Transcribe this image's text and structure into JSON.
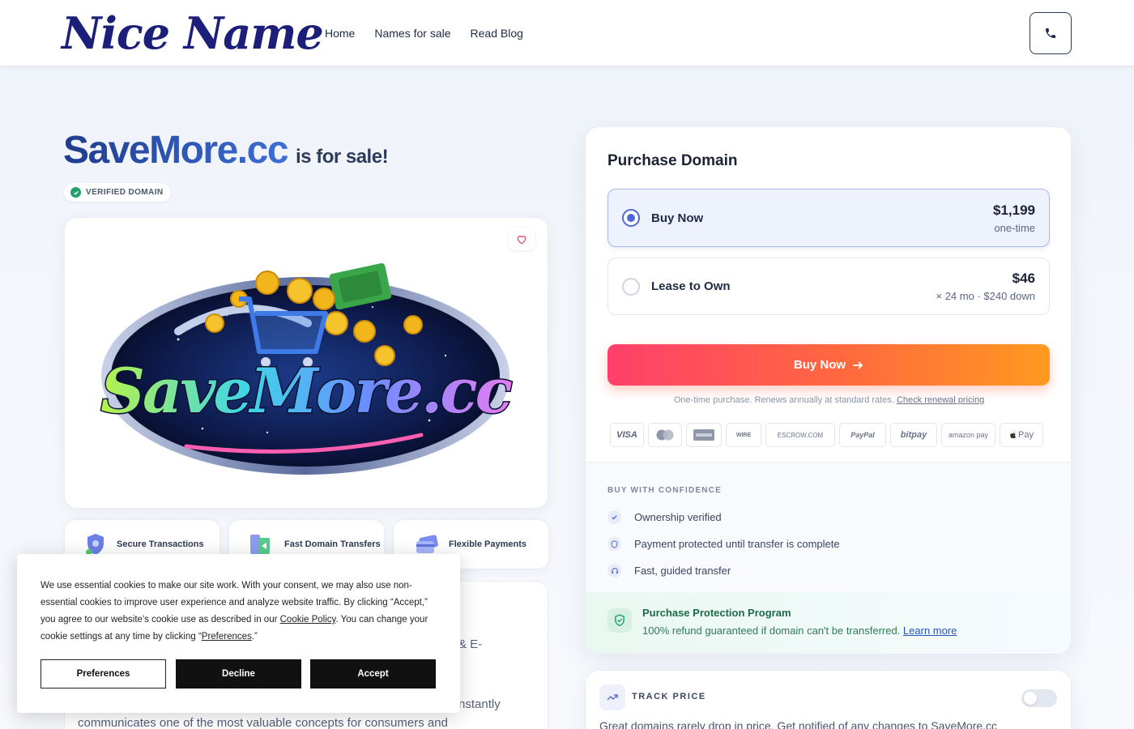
{
  "header": {
    "logo": "Nice Name",
    "nav": [
      "Home",
      "Names for sale",
      "Read Blog"
    ],
    "phone_icon": "phone-icon"
  },
  "listing": {
    "domain": "SaveMore.cc",
    "for_sale": "is for sale!",
    "verified": "VERIFIED DOMAIN",
    "logo_text": "SaveMore.cc",
    "features": [
      "Secure Transactions",
      "Fast Domain Transfers",
      "Flexible Payments"
    ],
    "desc_fragments": [
      "& E-",
      "nstantly",
      "communicates one of the most valuable concepts for consumers and"
    ]
  },
  "purchase": {
    "title": "Purchase Domain",
    "options": [
      {
        "label": "Buy Now",
        "price": "$1,199",
        "sub": "one-time",
        "selected": true
      },
      {
        "label": "Lease to Own",
        "price": "$46",
        "sub": "× 24 mo · $240 down",
        "selected": false
      }
    ],
    "button": "Buy Now",
    "note": "One-time purchase. Renews annually at standard rates.",
    "note_link": "Check renewal pricing",
    "payment_methods": [
      "VISA",
      "MasterCard",
      "AMEX",
      "WIRE",
      "ESCROW.COM",
      "PayPal",
      "bitpay",
      "amazon pay",
      "Pay"
    ],
    "confidence_title": "BUY WITH CONFIDENCE",
    "confidence_items": [
      "Ownership verified",
      "Payment protected until transfer is complete",
      "Fast, guided transfer"
    ],
    "protection_title": "Purchase Protection Program",
    "protection_text": "100% refund guaranteed if domain can't be transferred.",
    "protection_link": "Learn more"
  },
  "track": {
    "title": "TRACK PRICE",
    "text": "Great domains rarely drop in price. Get notified of any changes to SaveMore.cc"
  },
  "cookie": {
    "text1": "We use essential cookies to make our site work. With your consent, we may also use non-essential cookies to improve user experience and analyze website traffic. By clicking “Accept,” you agree to our website's cookie use as described in our ",
    "link1": "Cookie Policy",
    "text2": ". You can change your cookie settings at any time by clicking “",
    "link2": "Preferences",
    "text3": ".”",
    "preferences": "Preferences",
    "decline": "Decline",
    "accept": "Accept"
  },
  "colors": {
    "brand": "#1b1f7a",
    "accent": "#4f67d6",
    "cta_start": "#ff3f6b",
    "cta_end": "#ff9a1f",
    "success": "#22a06b"
  }
}
